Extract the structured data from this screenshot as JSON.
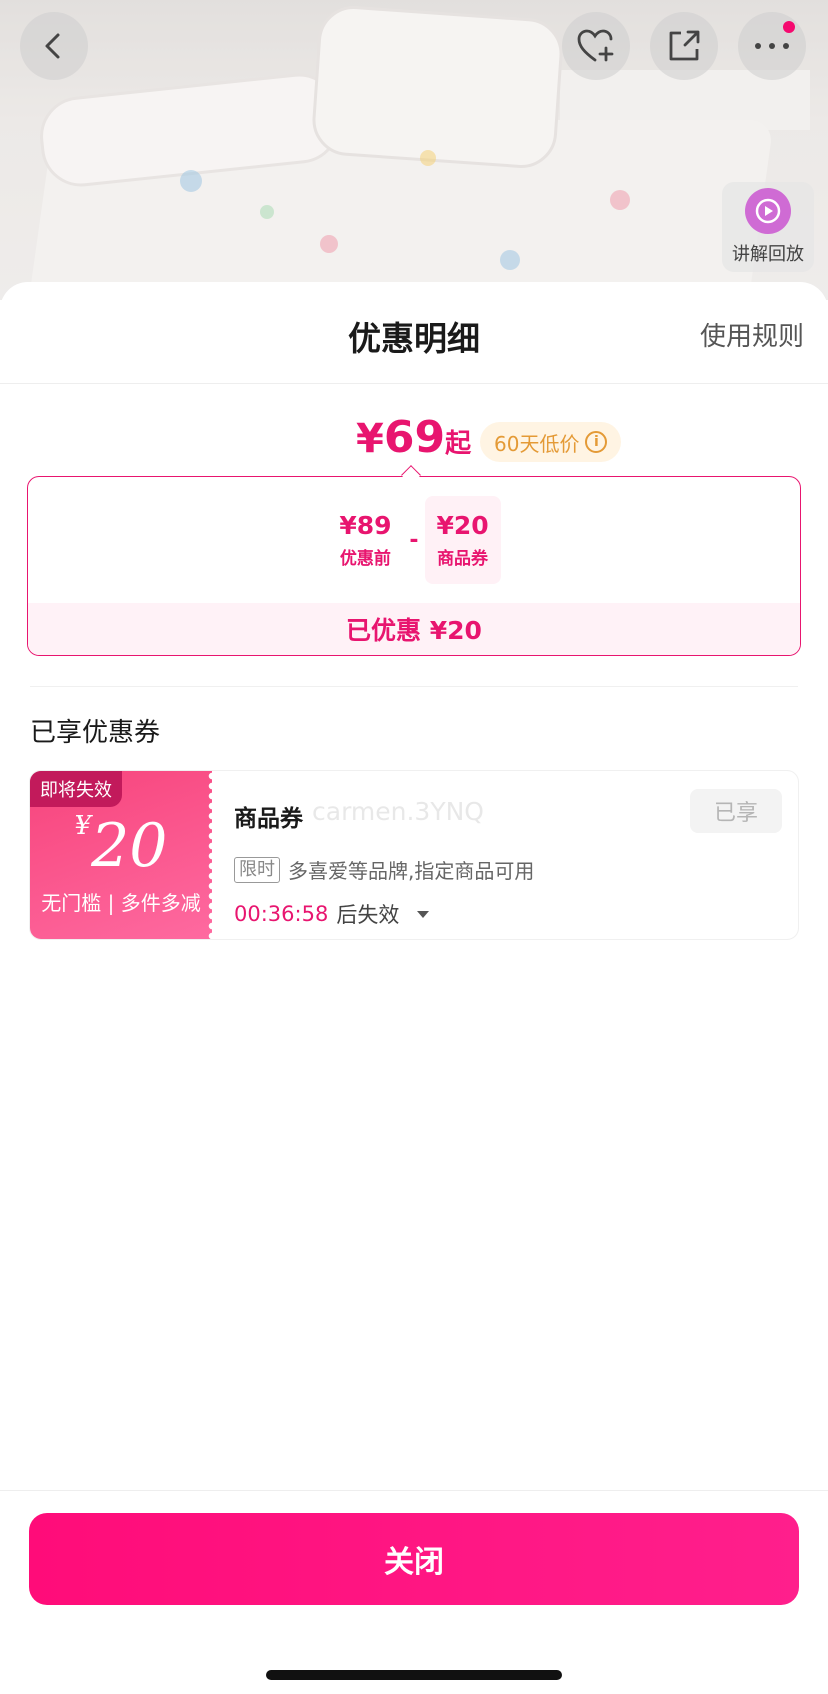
{
  "header": {
    "title": "优惠明细",
    "rules_label": "使用规则"
  },
  "top_bar": {
    "replay_label": "讲解回放",
    "icons": [
      "back-icon",
      "favorite-plus-icon",
      "share-icon",
      "more-icon",
      "replay-icon"
    ]
  },
  "price": {
    "currency": "¥",
    "final": "69",
    "suffix": "起",
    "low_tag": "60天低价"
  },
  "calculation": {
    "original_amount": "¥89",
    "original_label": "优惠前",
    "operator": "-",
    "coupon_amount": "¥20",
    "coupon_label": "商品券",
    "saved_text": "已优惠 ¥20"
  },
  "coupons_section": {
    "title": "已享优惠券",
    "coupon": {
      "expire_tag": "即将失效",
      "currency": "¥",
      "amount": "20",
      "condition": "无门槛 | 多件多减",
      "name": "商品券",
      "watermark": "carmen.3YNQ",
      "status_label": "已享",
      "limit_tag": "限时",
      "scope": "多喜爱等品牌,指定商品可用",
      "countdown": "00:36:58",
      "countdown_suffix": "后失效"
    }
  },
  "footer": {
    "close_label": "关闭"
  },
  "colors": {
    "accent": "#e8156f",
    "button": "#ff0c79",
    "coupon_gradient_start": "#f7447c",
    "low_tag_text": "#e49a36"
  }
}
